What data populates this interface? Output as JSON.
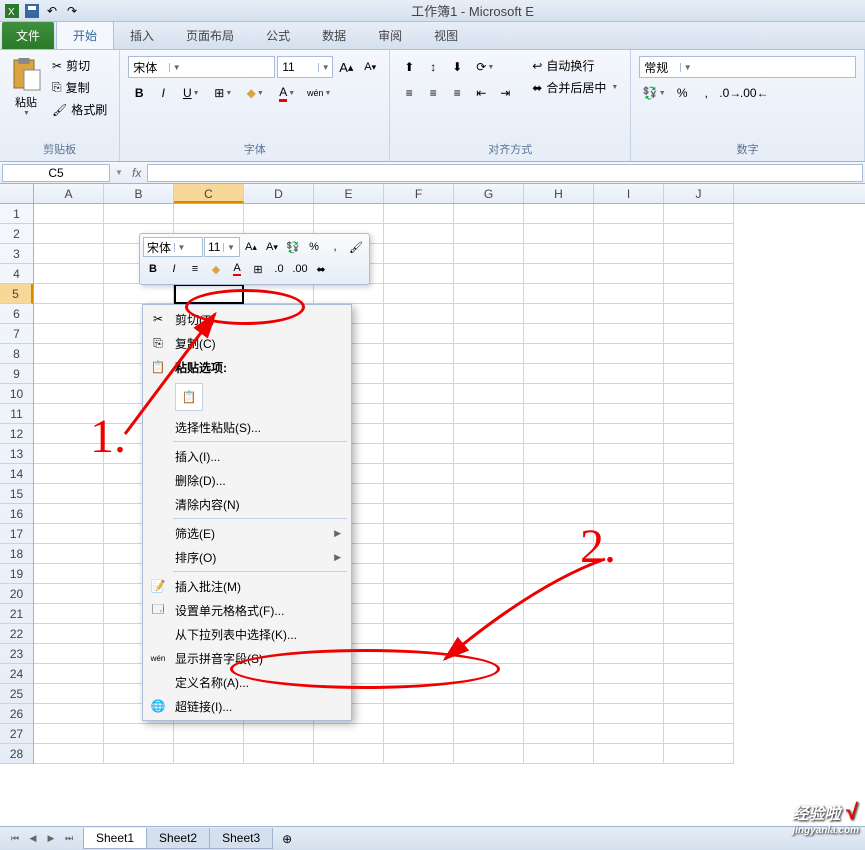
{
  "title": "工作簿1 - Microsoft E",
  "tabs": {
    "file": "文件",
    "home": "开始",
    "insert": "插入",
    "layout": "页面布局",
    "formula": "公式",
    "data": "数据",
    "review": "审阅",
    "view": "视图"
  },
  "ribbon": {
    "clipboard": {
      "label": "剪贴板",
      "paste": "粘贴",
      "cut": "剪切",
      "copy": "复制",
      "format_painter": "格式刷"
    },
    "font": {
      "label": "字体",
      "name": "宋体",
      "size": "11"
    },
    "alignment": {
      "label": "对齐方式",
      "wrap": "自动换行",
      "merge": "合并后居中"
    },
    "number": {
      "label": "数字",
      "format": "常规"
    }
  },
  "name_box": "C5",
  "columns": [
    "A",
    "B",
    "C",
    "D",
    "E",
    "F",
    "G",
    "H",
    "I",
    "J"
  ],
  "selected_col": "C",
  "rows": [
    1,
    2,
    3,
    4,
    5,
    6,
    7,
    8,
    9,
    10,
    11,
    12,
    13,
    14,
    15,
    16,
    17,
    18,
    19,
    20,
    21,
    22,
    23,
    24,
    25,
    26,
    27,
    28
  ],
  "selected_row": 5,
  "mini_toolbar": {
    "font": "宋体",
    "size": "11"
  },
  "context_menu": {
    "cut": "剪切(T)",
    "copy": "复制(C)",
    "paste_options": "粘贴选项:",
    "paste_special": "选择性粘贴(S)...",
    "insert": "插入(I)...",
    "delete": "删除(D)...",
    "clear": "清除内容(N)",
    "filter": "筛选(E)",
    "sort": "排序(O)",
    "insert_comment": "插入批注(M)",
    "format_cells": "设置单元格格式(F)...",
    "pick_from_list": "从下拉列表中选择(K)...",
    "show_pinyin": "显示拼音字段(S)",
    "define_name": "定义名称(A)...",
    "hyperlink": "超链接(I)..."
  },
  "sheets": [
    "Sheet1",
    "Sheet2",
    "Sheet3"
  ],
  "annotations": {
    "one": "1.",
    "two": "2."
  },
  "watermark": {
    "main": "经验啦",
    "sub": "jingyanla.com",
    "check": "√"
  }
}
